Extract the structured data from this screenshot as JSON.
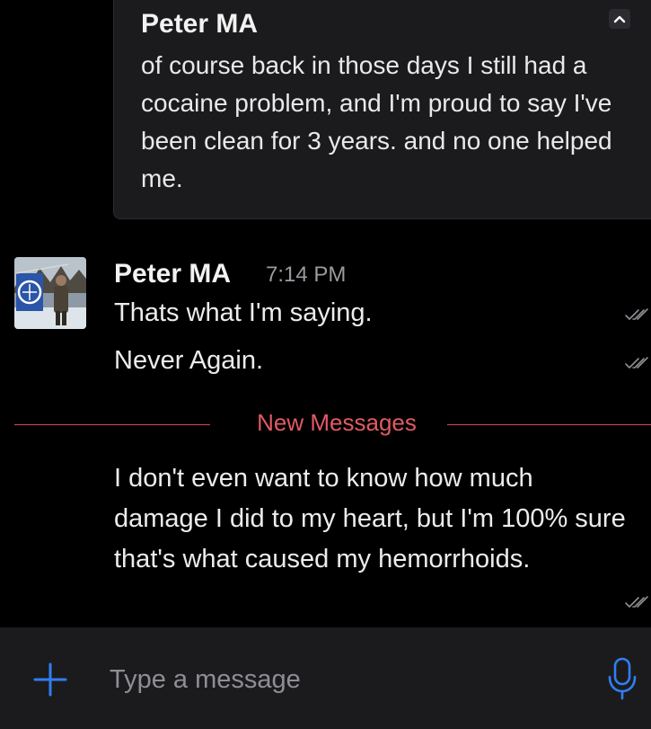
{
  "quoted_message": {
    "author": "Peter MA",
    "text": "of course back in those days I still had a cocaine problem, and I'm proud to say I've been clean for 3 years. and no one helped me."
  },
  "message_group": {
    "author": "Peter MA",
    "time": "7:14 PM",
    "lines": [
      "Thats what I'm saying.",
      "Never Again."
    ]
  },
  "new_messages_divider": {
    "label": "New Messages"
  },
  "new_message": {
    "text": "I don't even want to know how much damage I did to my heart, but I'm 100% sure that's what caused my hemorrhoids."
  },
  "composer": {
    "placeholder": "Type a message"
  },
  "icons": {
    "collapse": "chevron-up-icon",
    "read": "double-check-icon",
    "add": "plus-icon",
    "voice": "microphone-icon"
  },
  "colors": {
    "background": "#000000",
    "accent": "#2f7ff0",
    "new_messages": "#e05a63",
    "card": "#1b1b1e"
  }
}
